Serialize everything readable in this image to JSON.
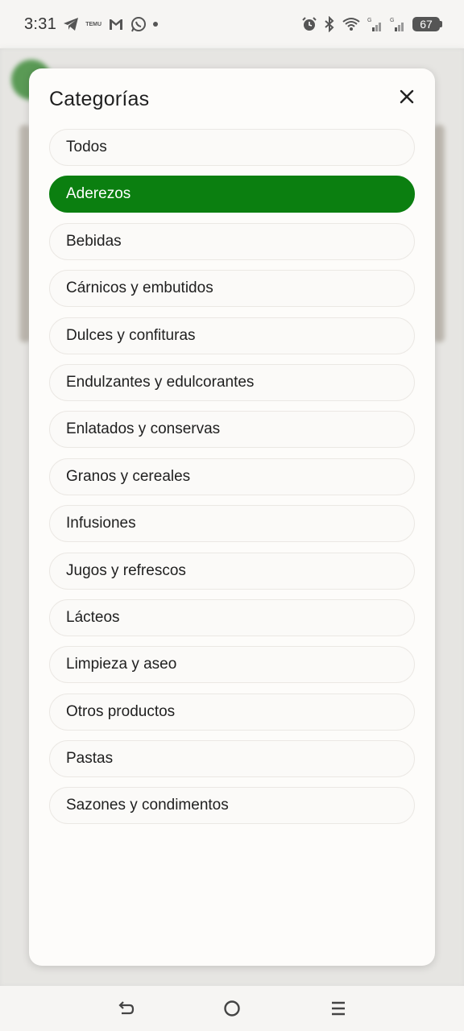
{
  "status_bar": {
    "time": "3:31",
    "battery": "67",
    "icons": [
      "telegram-icon",
      "temu-icon",
      "gmail-icon",
      "whatsapp-icon",
      "notification-dot",
      "alarm-icon",
      "bluetooth-icon",
      "wifi-icon",
      "signal-icon",
      "signal-icon"
    ],
    "temu_label": "TEMU",
    "signal_label": "G"
  },
  "modal": {
    "title": "Categorías",
    "close_icon": "close-icon",
    "selected_index": 1,
    "accent_color": "#0b7f10",
    "categories": [
      "Todos",
      "Aderezos",
      "Bebidas",
      "Cárnicos y embutidos",
      "Dulces y confituras",
      "Endulzantes y edulcorantes",
      "Enlatados y conservas",
      "Granos y cereales",
      "Infusiones",
      "Jugos y refrescos",
      "Lácteos",
      "Limpieza y aseo",
      "Otros productos",
      "Pastas",
      "Sazones y condimentos"
    ]
  },
  "nav_bar": {
    "icons": [
      "back-icon",
      "home-icon",
      "recents-icon"
    ]
  }
}
